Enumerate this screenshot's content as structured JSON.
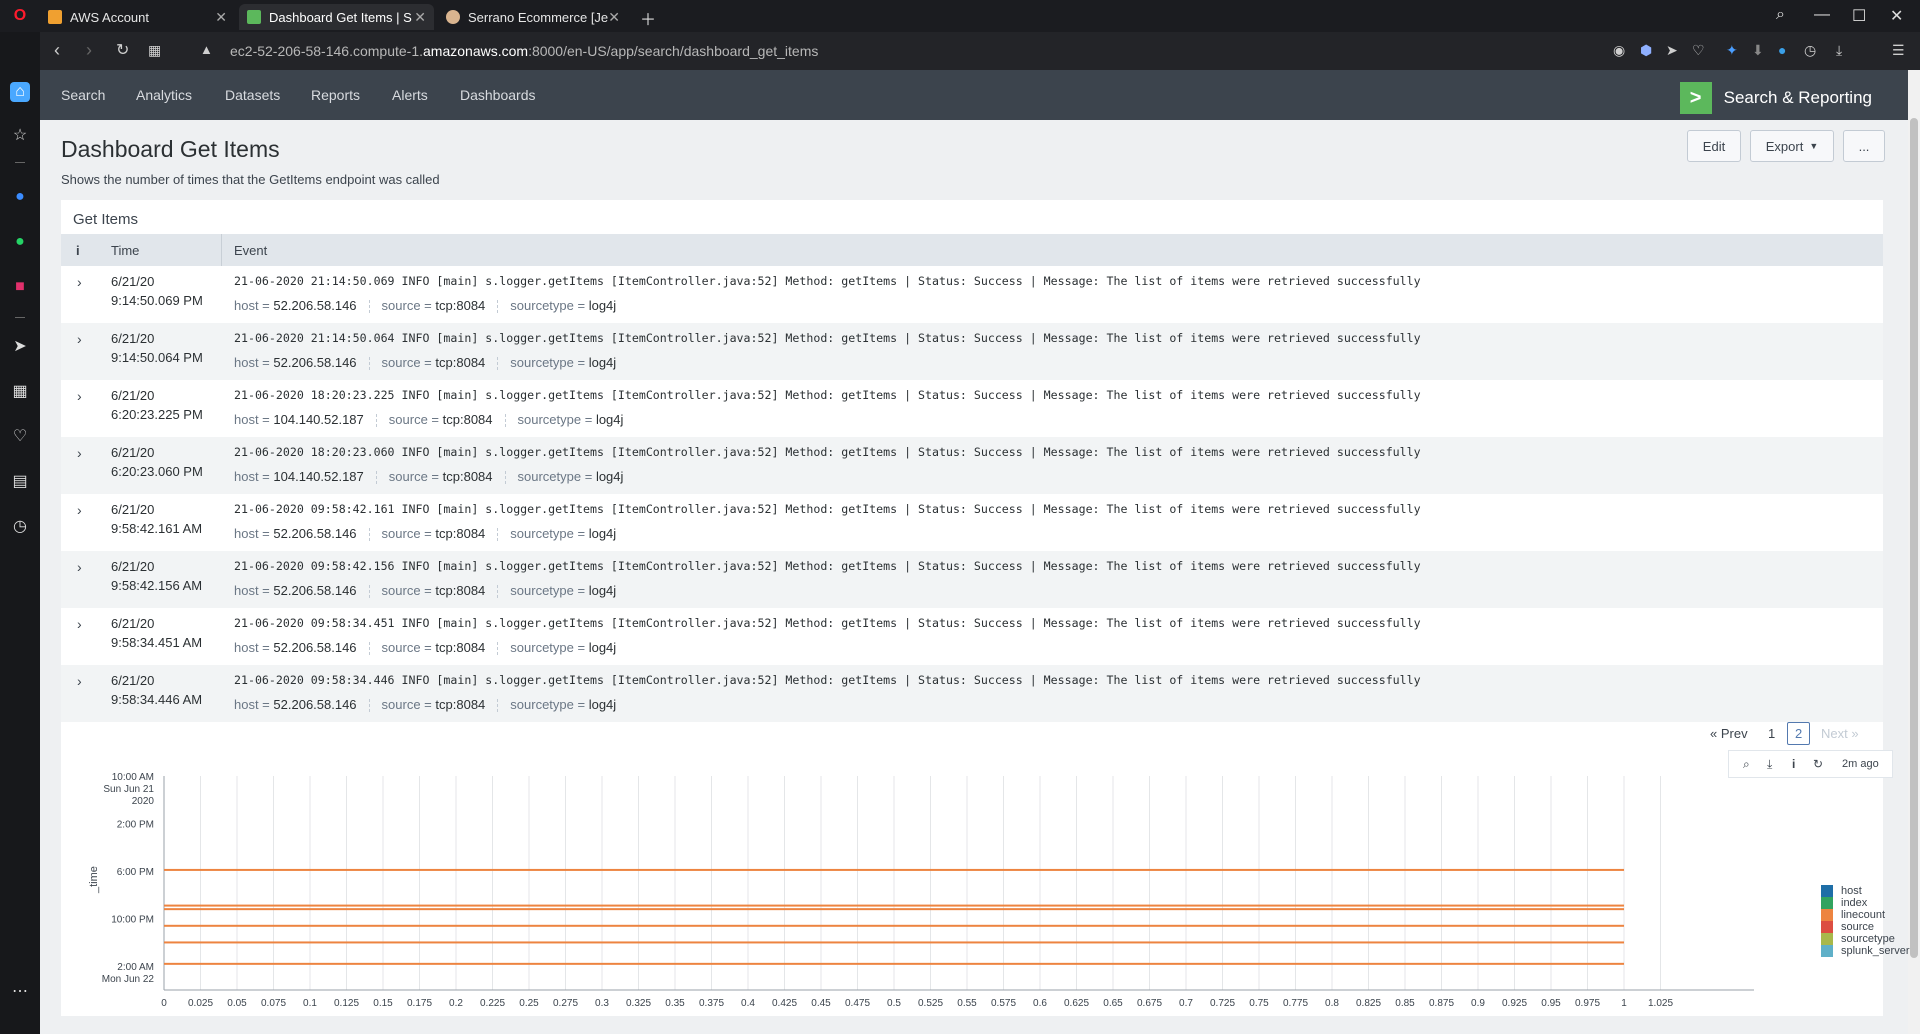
{
  "browser": {
    "tabs": [
      {
        "title": "AWS Account",
        "icon": "aws-box-icon",
        "color": "#f0a030"
      },
      {
        "title": "Dashboard Get Items | S",
        "icon": "splunk-icon",
        "color": "#5cb85c"
      },
      {
        "title": "Serrano Ecommerce [Je",
        "icon": "jenkins-icon",
        "color": "#d9b48f"
      }
    ],
    "url_prefix": "ec2-52-206-58-146.compute-1.",
    "url_domain": "amazonaws.com",
    "url_suffix": ":8000/en-US/app/search/dashboard_get_items"
  },
  "app": {
    "menu": [
      "Search",
      "Analytics",
      "Datasets",
      "Reports",
      "Alerts",
      "Dashboards"
    ],
    "brand": "Search & Reporting",
    "brand_color": "#5cb85c"
  },
  "dashboard": {
    "title": "Dashboard Get Items",
    "description": "Shows the number of times that the GetItems endpoint was called",
    "edit_label": "Edit",
    "export_label": "Export",
    "more_label": "...",
    "panel_title": "Get Items",
    "col_info": "i",
    "col_time": "Time",
    "col_event": "Event",
    "key_host": "host =",
    "key_source": "source =",
    "key_sourcetype": "sourcetype =",
    "events": [
      {
        "date": "6/21/20",
        "time": "9:14:50.069 PM",
        "event": "21-06-2020 21:14:50.069 INFO [main] s.logger.getItems [ItemController.java:52] Method: getItems | Status: Success | Message: The list of items were retrieved successfully",
        "host": "52.206.58.146",
        "source": "tcp:8084",
        "sourcetype": "log4j"
      },
      {
        "date": "6/21/20",
        "time": "9:14:50.064 PM",
        "event": "21-06-2020 21:14:50.064 INFO [main] s.logger.getItems [ItemController.java:52] Method: getItems | Status: Success | Message: The list of items were retrieved successfully",
        "host": "52.206.58.146",
        "source": "tcp:8084",
        "sourcetype": "log4j"
      },
      {
        "date": "6/21/20",
        "time": "6:20:23.225 PM",
        "event": "21-06-2020 18:20:23.225 INFO [main] s.logger.getItems [ItemController.java:52] Method: getItems | Status: Success | Message: The list of items were retrieved successfully",
        "host": "104.140.52.187",
        "source": "tcp:8084",
        "sourcetype": "log4j"
      },
      {
        "date": "6/21/20",
        "time": "6:20:23.060 PM",
        "event": "21-06-2020 18:20:23.060 INFO [main] s.logger.getItems [ItemController.java:52] Method: getItems | Status: Success | Message: The list of items were retrieved successfully",
        "host": "104.140.52.187",
        "source": "tcp:8084",
        "sourcetype": "log4j"
      },
      {
        "date": "6/21/20",
        "time": "9:58:42.161 AM",
        "event": "21-06-2020 09:58:42.161 INFO [main] s.logger.getItems [ItemController.java:52] Method: getItems | Status: Success | Message: The list of items were retrieved successfully",
        "host": "52.206.58.146",
        "source": "tcp:8084",
        "sourcetype": "log4j"
      },
      {
        "date": "6/21/20",
        "time": "9:58:42.156 AM",
        "event": "21-06-2020 09:58:42.156 INFO [main] s.logger.getItems [ItemController.java:52] Method: getItems | Status: Success | Message: The list of items were retrieved successfully",
        "host": "52.206.58.146",
        "source": "tcp:8084",
        "sourcetype": "log4j"
      },
      {
        "date": "6/21/20",
        "time": "9:58:34.451 AM",
        "event": "21-06-2020 09:58:34.451 INFO [main] s.logger.getItems [ItemController.java:52] Method: getItems | Status: Success | Message: The list of items were retrieved successfully",
        "host": "52.206.58.146",
        "source": "tcp:8084",
        "sourcetype": "log4j"
      },
      {
        "date": "6/21/20",
        "time": "9:58:34.446 AM",
        "event": "21-06-2020 09:58:34.446 INFO [main] s.logger.getItems [ItemController.java:52] Method: getItems | Status: Success | Message: The list of items were retrieved successfully",
        "host": "52.206.58.146",
        "source": "tcp:8084",
        "sourcetype": "log4j"
      }
    ],
    "pager": {
      "prev": "« Prev",
      "pages": [
        "1",
        "2"
      ],
      "current": "2",
      "next": "Next »"
    },
    "refresh_time": "2m ago"
  },
  "chart_data": {
    "type": "bar",
    "orientation": "horizontal",
    "ylabel": "_time",
    "y_ticks": [
      "10:00 AM\nSun Jun 21\n2020",
      "2:00 PM",
      "6:00 PM",
      "10:00 PM",
      "2:00 AM\nMon Jun 22"
    ],
    "x_ticks": [
      "0",
      "0.025",
      "0.05",
      "0.075",
      "0.1",
      "0.125",
      "0.15",
      "0.175",
      "0.2",
      "0.225",
      "0.25",
      "0.275",
      "0.3",
      "0.325",
      "0.35",
      "0.375",
      "0.4",
      "0.425",
      "0.45",
      "0.475",
      "0.5",
      "0.525",
      "0.55",
      "0.575",
      "0.6",
      "0.625",
      "0.65",
      "0.675",
      "0.7",
      "0.725",
      "0.75",
      "0.775",
      "0.8",
      "0.825",
      "0.85",
      "0.875",
      "0.9",
      "0.925",
      "0.95",
      "0.975",
      "1",
      "1.025"
    ],
    "xlim": [
      0,
      1.025
    ],
    "ylim_hours": [
      10,
      28
    ],
    "grid": true,
    "legend_position": "right",
    "series": [
      {
        "name": "host",
        "color": "#1e6ea7"
      },
      {
        "name": "index",
        "color": "#31a35f"
      },
      {
        "name": "linecount",
        "color": "#ed8440"
      },
      {
        "name": "source",
        "color": "#dc4e41"
      },
      {
        "name": "sourcetype",
        "color": "#a8b84b"
      },
      {
        "name": "splunk_server",
        "color": "#5fb0c8"
      }
    ],
    "bars": [
      {
        "hour": 17.9,
        "value": 1
      },
      {
        "hour": 20.9,
        "value": 1
      },
      {
        "hour": 21.2,
        "value": 1
      },
      {
        "hour": 22.6,
        "value": 1
      },
      {
        "hour": 24.0,
        "value": 1
      },
      {
        "hour": 25.8,
        "value": 1
      }
    ]
  }
}
